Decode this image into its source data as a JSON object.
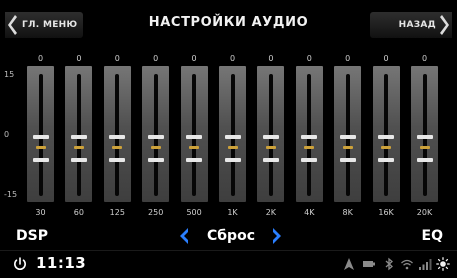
{
  "header": {
    "back_label": "ГЛ. МЕНЮ",
    "title": "НАСТРОЙКИ АУДИО",
    "forward_label": "НАЗАД"
  },
  "equalizer": {
    "scale": {
      "max": "15",
      "zero": "0",
      "min": "-15"
    },
    "bands": [
      {
        "freq": "30",
        "gain": "0"
      },
      {
        "freq": "60",
        "gain": "0"
      },
      {
        "freq": "125",
        "gain": "0"
      },
      {
        "freq": "250",
        "gain": "0"
      },
      {
        "freq": "500",
        "gain": "0"
      },
      {
        "freq": "1K",
        "gain": "0"
      },
      {
        "freq": "2K",
        "gain": "0"
      },
      {
        "freq": "4K",
        "gain": "0"
      },
      {
        "freq": "8K",
        "gain": "0"
      },
      {
        "freq": "16K",
        "gain": "0"
      },
      {
        "freq": "20K",
        "gain": "0"
      }
    ]
  },
  "mode_bar": {
    "dsp_label": "DSP",
    "preset_label": "Сброс",
    "eq_label": "EQ"
  },
  "status_bar": {
    "time": "11:13",
    "icons": [
      "navigation-icon",
      "battery-icon",
      "bluetooth-icon",
      "wifi-icon",
      "signal-icon",
      "brightness-icon"
    ]
  },
  "colors": {
    "accent_blue": "#2a7fff",
    "knob_accent": "#cda23a",
    "background": "#000000"
  }
}
